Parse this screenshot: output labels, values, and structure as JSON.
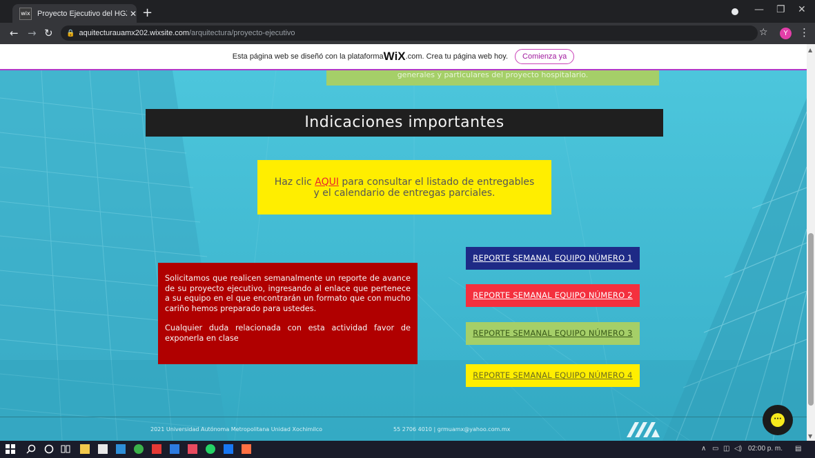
{
  "browser": {
    "tab_title": "Proyecto Ejecutivo del HGZT | Ar",
    "tab_favicon_text": "wix",
    "url_host": "aquitecturauamx202.wixsite.com",
    "url_path": "/arquitectura/proyecto-ejecutivo",
    "avatar_letter": "Y"
  },
  "wix_banner": {
    "text_before": "Esta página web se diseñó con la plataforma ",
    "logo": "WiX",
    "text_after": ".com. Crea tu página web hoy.",
    "button": "Comienza ya"
  },
  "page": {
    "top_box_text": "generales y particulares del proyecto hospitalario.",
    "heading": "Indicaciones importantes",
    "info_line1_prefix": "Haz clic ",
    "info_link": "AQUI",
    "info_line1_suffix": " para consultar el listado de entregables",
    "info_line2": "y el calendario de entregas parciales.",
    "red_paragraph1": "Solicitamos que realicen semanalmente un reporte de avance de su proyecto ejecutivo, ingresando al enlace que pertenece a su equipo en el que encontrarán un formato que con mucho cariño hemos preparado para ustedes.",
    "red_paragraph2": "Cualquier duda relacionada con esta actividad favor de exponerla en clase",
    "reports": [
      "REPORTE SEMANAL EQUIPO NÚMERO 1",
      "REPORTE SEMANAL EQUIPO NÚMERO 2",
      "REPORTE SEMANAL EQUIPO NÚMERO 3",
      "REPORTE SEMANAL EQUIPO NÚMERO 4"
    ],
    "footer_left": "2021 Universidad Autónoma Metropolitana Unidad Xochimilco",
    "footer_contact": "55 2706 4010  |  grmuamx@yahoo.com.mx",
    "chat_glyph": "···"
  },
  "taskbar": {
    "time": "02:00 p. m."
  },
  "colors": {
    "page_bg": "#3dbcd4",
    "heading_bg": "#1f1f1f",
    "yellow": "#ffee00",
    "red": "#b00000",
    "blue_btn": "#1e2a86",
    "red_btn": "#f4303e",
    "green_btn": "#a5cf68"
  }
}
